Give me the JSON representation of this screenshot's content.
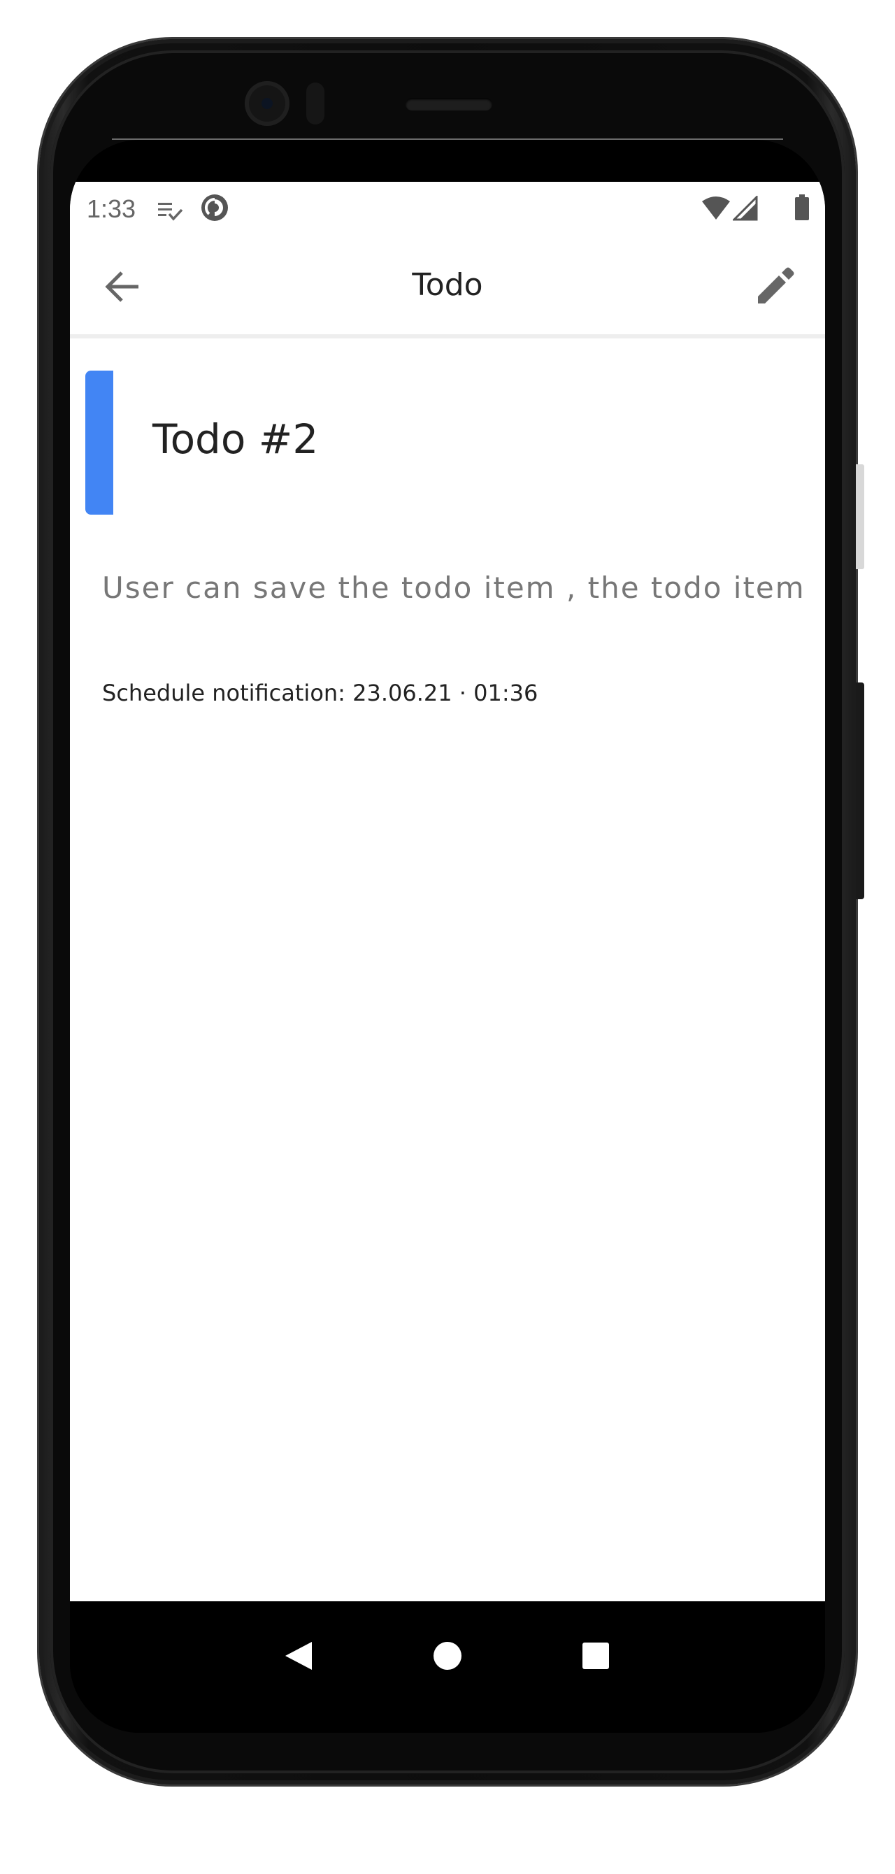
{
  "status_bar": {
    "time": "1:33",
    "icons": [
      "playlist-check-icon",
      "pocket-casts-icon",
      "wifi-icon",
      "signal-icon",
      "battery-icon"
    ]
  },
  "app_bar": {
    "title": "Todo",
    "back_icon": "arrow-back-icon",
    "edit_icon": "pencil-icon"
  },
  "todo": {
    "title": "Todo #2",
    "color": "#4285f4",
    "description": "User can save the todo item , the todo item",
    "schedule": "Schedule notification: 23.06.21 · 01:36"
  },
  "nav_bar": {
    "buttons": [
      "back-triangle-icon",
      "home-circle-icon",
      "recents-square-icon"
    ]
  }
}
